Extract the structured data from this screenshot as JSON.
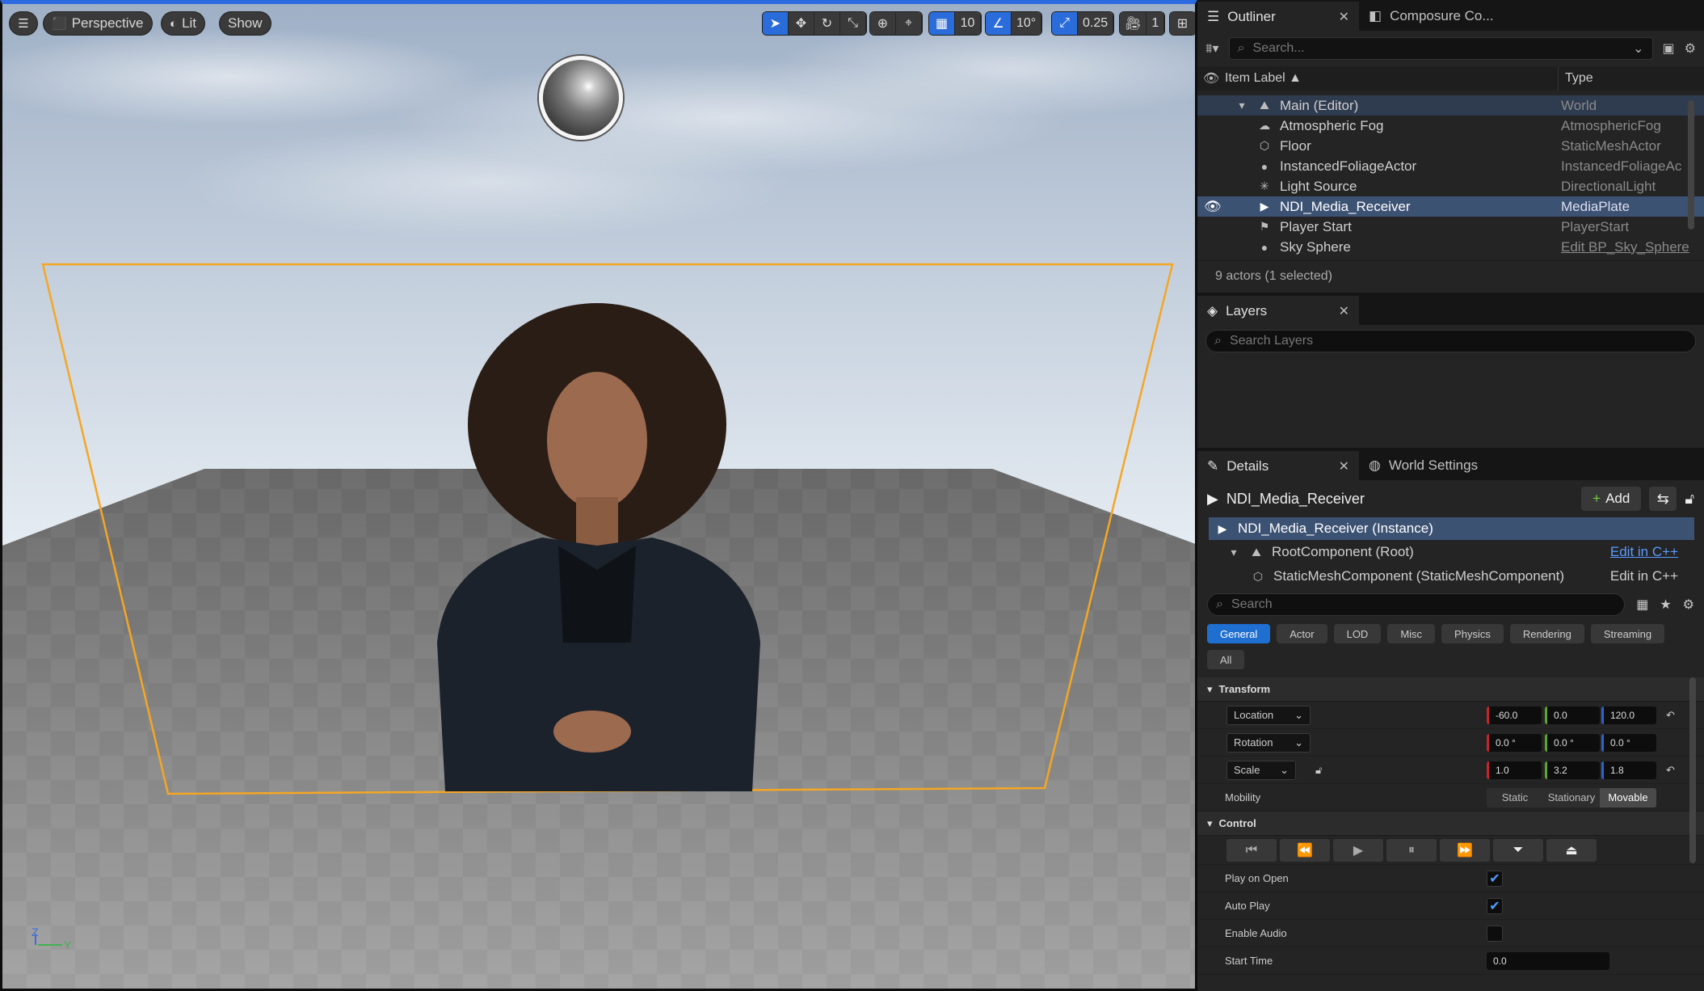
{
  "viewport": {
    "perspective_label": "Perspective",
    "lit_label": "Lit",
    "show_label": "Show",
    "grid_snap": "10",
    "rotation_snap": "10°",
    "scale_snap": "0.25",
    "camera_speed": "1",
    "axis_z": "Z",
    "axis_y": "Y",
    "selection_color": "#f5a623"
  },
  "outliner": {
    "tab_label": "Outliner",
    "tab2_label": "Composure Co...",
    "search_placeholder": "Search...",
    "col_label": "Item Label ▲",
    "col_type": "Type",
    "items": [
      {
        "label": "Main (Editor)",
        "type": "World",
        "icon": "world-icon"
      },
      {
        "label": "Atmospheric Fog",
        "type": "AtmosphericFog",
        "icon": "fog-icon"
      },
      {
        "label": "Floor",
        "type": "StaticMeshActor",
        "icon": "mesh-icon"
      },
      {
        "label": "InstancedFoliageActor",
        "type": "InstancedFoliageAc",
        "icon": "foliage-icon"
      },
      {
        "label": "Light Source",
        "type": "DirectionalLight",
        "icon": "light-icon"
      },
      {
        "label": "NDI_Media_Receiver",
        "type": "MediaPlate",
        "icon": "media-plate-icon"
      },
      {
        "label": "Player Start",
        "type": "PlayerStart",
        "icon": "player-start-icon"
      },
      {
        "label": "Sky Sphere",
        "type": "Edit BP_Sky_Sphere",
        "icon": "sphere-icon"
      }
    ],
    "status": "9 actors (1 selected)"
  },
  "layers": {
    "tab_label": "Layers",
    "search_placeholder": "Search Layers"
  },
  "details": {
    "tab_label": "Details",
    "tab2_label": "World Settings",
    "actor_name": "NDI_Media_Receiver",
    "add_label": "Add",
    "components": [
      {
        "label": "NDI_Media_Receiver (Instance)",
        "link": ""
      },
      {
        "label": "RootComponent (Root)",
        "link": "Edit in C++"
      },
      {
        "label": "StaticMeshComponent (StaticMeshComponent)",
        "link": "Edit in C++"
      }
    ],
    "search_placeholder": "Search",
    "categories": [
      "General",
      "Actor",
      "LOD",
      "Misc",
      "Physics",
      "Rendering",
      "Streaming",
      "All"
    ],
    "transform_label": "Transform",
    "location": {
      "label": "Location",
      "x": "-60.0",
      "y": "0.0",
      "z": "120.0"
    },
    "rotation": {
      "label": "Rotation",
      "x": "0.0 °",
      "y": "0.0 °",
      "z": "0.0 °"
    },
    "scale": {
      "label": "Scale",
      "x": "1.0",
      "y": "3.2",
      "z": "1.8"
    },
    "mobility": {
      "label": "Mobility",
      "static": "Static",
      "stationary": "Stationary",
      "movable": "Movable"
    },
    "control_label": "Control",
    "play_on_open": {
      "label": "Play on Open",
      "checked": true
    },
    "auto_play": {
      "label": "Auto Play",
      "checked": true
    },
    "enable_audio": {
      "label": "Enable Audio",
      "checked": false
    },
    "start_time": {
      "label": "Start Time",
      "value": "0.0"
    }
  }
}
